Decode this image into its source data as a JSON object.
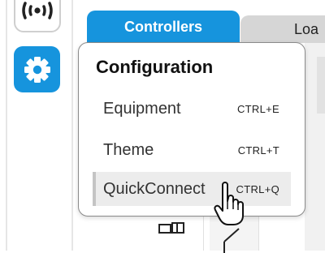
{
  "sidebar": {
    "items": [
      {
        "icon": "wireless-signal-icon"
      },
      {
        "icon": "gear-icon",
        "active": true,
        "accent": "#1694dd"
      }
    ]
  },
  "tabs": [
    {
      "label": "Controllers",
      "active": true
    },
    {
      "label": "Loa",
      "active": false
    }
  ],
  "menu": {
    "title": "Configuration",
    "items": [
      {
        "label": "Equipment",
        "shortcut": "CTRL+E"
      },
      {
        "label": "Theme",
        "shortcut": "CTRL+T"
      },
      {
        "label": "QuickConnect",
        "shortcut": "CTRL+Q",
        "hovered": true
      }
    ]
  },
  "colors": {
    "accent": "#1694dd",
    "inactive_tab": "#d6d6d6",
    "menu_border": "#8a8a8a",
    "hover_bg": "#ececec"
  },
  "cursor": {
    "type": "hand-pointer"
  }
}
